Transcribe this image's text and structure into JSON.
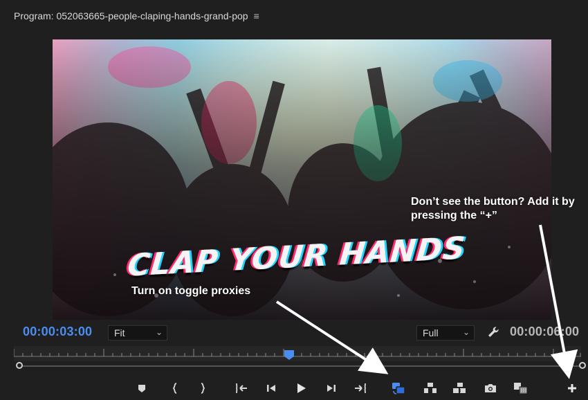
{
  "panel": {
    "title": "Program: 052063665-people-claping-hands-grand-pop",
    "menu_icon": "hamburger-menu-icon"
  },
  "video": {
    "overlay_title": "CLAP YOUR HANDS"
  },
  "annotations": {
    "toggle_proxies": "Turn on toggle proxies",
    "add_button": "Don’t see the button? Add it by pressing the “+”"
  },
  "info_bar": {
    "current_timecode": "00:00:03:00",
    "zoom_label": "Fit",
    "resolution_label": "Full",
    "duration_timecode": "00:00:06:00",
    "settings_icon": "wrench-icon"
  },
  "colors": {
    "accent_blue": "#4c8ef0",
    "background": "#1f1f1f",
    "annotation_text": "#ffffff"
  },
  "transport": {
    "buttons": [
      {
        "name": "add-marker-button",
        "icon": "marker-icon"
      },
      {
        "name": "mark-in-button",
        "icon": "mark-in-icon"
      },
      {
        "name": "mark-out-button",
        "icon": "mark-out-icon"
      },
      {
        "name": "go-to-in-button",
        "icon": "go-to-in-icon"
      },
      {
        "name": "step-back-button",
        "icon": "step-back-icon"
      },
      {
        "name": "play-button",
        "icon": "play-icon"
      },
      {
        "name": "step-forward-button",
        "icon": "step-forward-icon"
      },
      {
        "name": "go-to-out-button",
        "icon": "go-to-out-icon"
      },
      {
        "name": "toggle-proxies-button",
        "icon": "toggle-proxies-icon",
        "active": true
      },
      {
        "name": "lift-button",
        "icon": "lift-icon"
      },
      {
        "name": "extract-button",
        "icon": "extract-icon"
      },
      {
        "name": "export-frame-button",
        "icon": "camera-icon"
      },
      {
        "name": "comparison-view-button",
        "icon": "comparison-view-icon"
      },
      {
        "name": "button-editor-button",
        "icon": "plus-icon"
      }
    ]
  }
}
